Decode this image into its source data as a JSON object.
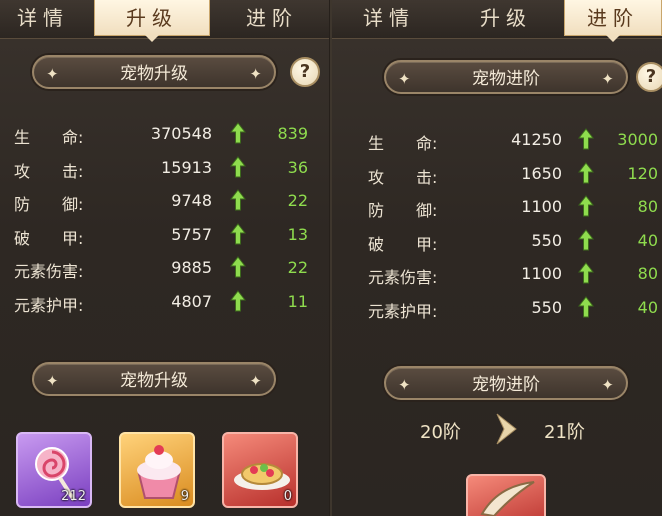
{
  "left": {
    "tabs": [
      "详情",
      "升级",
      "进阶"
    ],
    "active_tab": 1,
    "title": "宠物升级",
    "help": "?",
    "stats": [
      {
        "label": "生　　命:",
        "value": "370548",
        "gain": "839"
      },
      {
        "label": "攻　　击:",
        "value": "15913",
        "gain": "36"
      },
      {
        "label": "防　　御:",
        "value": "9748",
        "gain": "22"
      },
      {
        "label": "破　　甲:",
        "value": "5757",
        "gain": "13"
      },
      {
        "label": "元素伤害:",
        "value": "9885",
        "gain": "22"
      },
      {
        "label": "元素护甲:",
        "value": "4807",
        "gain": "11"
      }
    ],
    "section_title": "宠物升级",
    "items": [
      {
        "name": "lollipop-icon",
        "count": "212",
        "bg": "#a56be0"
      },
      {
        "name": "cupcake-icon",
        "count": "9",
        "bg": "#f0b24a"
      },
      {
        "name": "cake-plate-icon",
        "count": "0",
        "bg": "#d9534f"
      }
    ]
  },
  "right": {
    "tabs": [
      "详情",
      "升级",
      "进阶"
    ],
    "active_tab": 2,
    "title": "宠物进阶",
    "help": "?",
    "stats": [
      {
        "label": "生　　命:",
        "value": "41250",
        "gain": "3000"
      },
      {
        "label": "攻　　击:",
        "value": "1650",
        "gain": "120"
      },
      {
        "label": "防　　御:",
        "value": "1100",
        "gain": "80"
      },
      {
        "label": "破　　甲:",
        "value": "550",
        "gain": "40"
      },
      {
        "label": "元素伤害:",
        "value": "1100",
        "gain": "80"
      },
      {
        "label": "元素护甲:",
        "value": "550",
        "gain": "40"
      }
    ],
    "section_title": "宠物进阶",
    "stage_from": "20阶",
    "stage_to": "21阶",
    "items": [
      {
        "name": "horn-icon",
        "bg": "#d9534f"
      }
    ]
  },
  "colors": {
    "gain": "#8fdc4e",
    "arrow": "#8fdc4e",
    "tab_active_bg": "#f1dfbf"
  }
}
